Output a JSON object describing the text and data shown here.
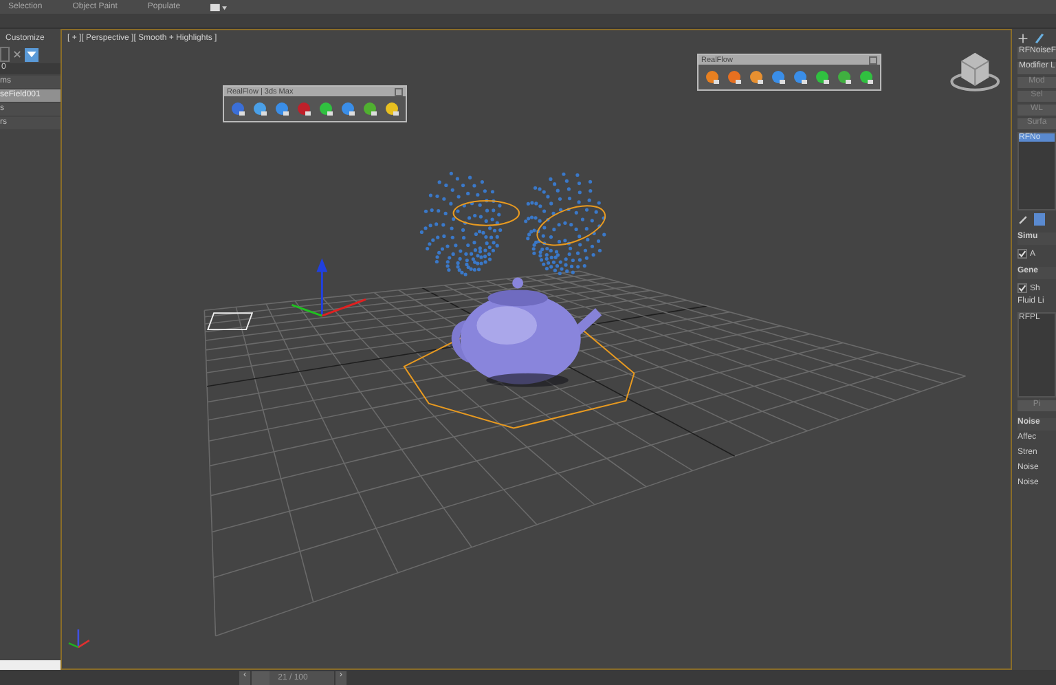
{
  "menu": [
    "Selection",
    "Object Paint",
    "Populate"
  ],
  "left_panel": {
    "tab": "Customize",
    "field": "0",
    "items": [
      {
        "label": "ms",
        "selected": false
      },
      {
        "label": "seField001",
        "selected": true
      },
      {
        "label": "s",
        "selected": false
      },
      {
        "label": "rs",
        "selected": false
      }
    ]
  },
  "viewport": {
    "label": "[ + ][ Perspective ][ Smooth + Highlights ]"
  },
  "toolbars": [
    {
      "title": "RealFlow | 3ds Max"
    },
    {
      "title": "RealFlow"
    }
  ],
  "right_panel": {
    "object_name": "RFNoiseF",
    "modifier_list": "Modifier L",
    "buttons": [
      "Mod",
      "Sel",
      "WL",
      "Surfa"
    ],
    "stack_item": "RFNo",
    "rows": [
      {
        "kind": "header",
        "text": "Simu"
      },
      {
        "kind": "check",
        "text": "A",
        "checked": true
      },
      {
        "kind": "header",
        "text": "Gene"
      },
      {
        "kind": "check",
        "text": "Sh",
        "checked": true
      },
      {
        "kind": "label",
        "text": "Fluid Li"
      },
      {
        "kind": "list",
        "text": "RFPL"
      },
      {
        "kind": "button",
        "text": "Pi"
      },
      {
        "kind": "header",
        "text": "Noise"
      },
      {
        "kind": "label",
        "text": "Affec"
      },
      {
        "kind": "label",
        "text": "Stren"
      },
      {
        "kind": "label",
        "text": "Noise"
      },
      {
        "kind": "label",
        "text": "Noise"
      }
    ]
  },
  "timeline": {
    "prev": "‹",
    "frame": "21 / 100",
    "next": "›",
    "level": 0.21
  }
}
